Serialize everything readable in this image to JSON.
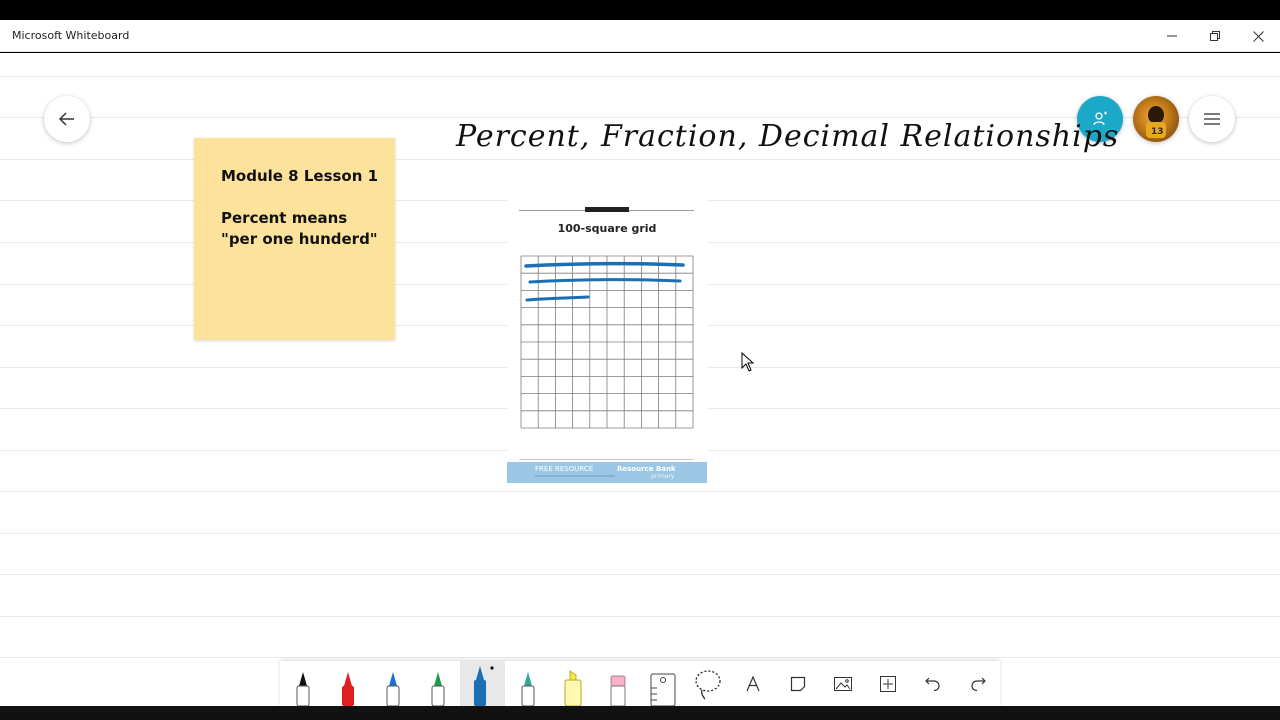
{
  "window": {
    "title": "Microsoft Whiteboard",
    "controls": [
      "minimize",
      "restore",
      "close"
    ]
  },
  "board": {
    "title": "Percent, Fraction, Decimal Relationships",
    "sticky_note": {
      "color": "#fde29c",
      "lines": [
        "Module 8 Lesson 1",
        "",
        "Percent means",
        "\"per one hunderd\""
      ]
    },
    "worksheet": {
      "heading": "100-square grid",
      "grid_rows": 10,
      "grid_cols": 10,
      "highlighted_squares": 25,
      "ink_color": "#1b6fb5",
      "banner_left": "FREE RESOURCE",
      "banner_right": "Resource Bank",
      "banner_right_sub": "primary"
    }
  },
  "header_buttons": {
    "back": "arrow-left-icon",
    "share": "share-user-icon",
    "profile": "user-avatar",
    "menu": "hamburger-menu-icon"
  },
  "colors": {
    "accent": "#1ba9c7",
    "ruled_line": "#e9e9e9"
  },
  "toolbar": {
    "tools": [
      {
        "name": "pen-black",
        "type": "pen",
        "color": "#111111"
      },
      {
        "name": "pen-red",
        "type": "pen",
        "color": "#e02020"
      },
      {
        "name": "pen-blue",
        "type": "pen",
        "color": "#1e6fd0"
      },
      {
        "name": "pen-green",
        "type": "pen",
        "color": "#1f9a4a"
      },
      {
        "name": "pen-blue-selected",
        "type": "pen",
        "color": "#1b6fb5",
        "selected": true
      },
      {
        "name": "pen-rainbow",
        "type": "pen",
        "color": "#2ea89c"
      },
      {
        "name": "highlighter-yellow",
        "type": "highlighter",
        "color": "#f5e84a"
      },
      {
        "name": "eraser",
        "type": "eraser",
        "color": "#f6b3c8"
      },
      {
        "name": "ruler",
        "type": "ruler"
      },
      {
        "name": "lasso-select",
        "type": "lasso"
      },
      {
        "name": "text",
        "type": "text",
        "label": "A"
      },
      {
        "name": "sticky-note",
        "type": "note"
      },
      {
        "name": "insert-image",
        "type": "image"
      },
      {
        "name": "insert-menu",
        "type": "plus"
      },
      {
        "name": "undo",
        "type": "undo"
      },
      {
        "name": "redo",
        "type": "redo"
      }
    ]
  }
}
